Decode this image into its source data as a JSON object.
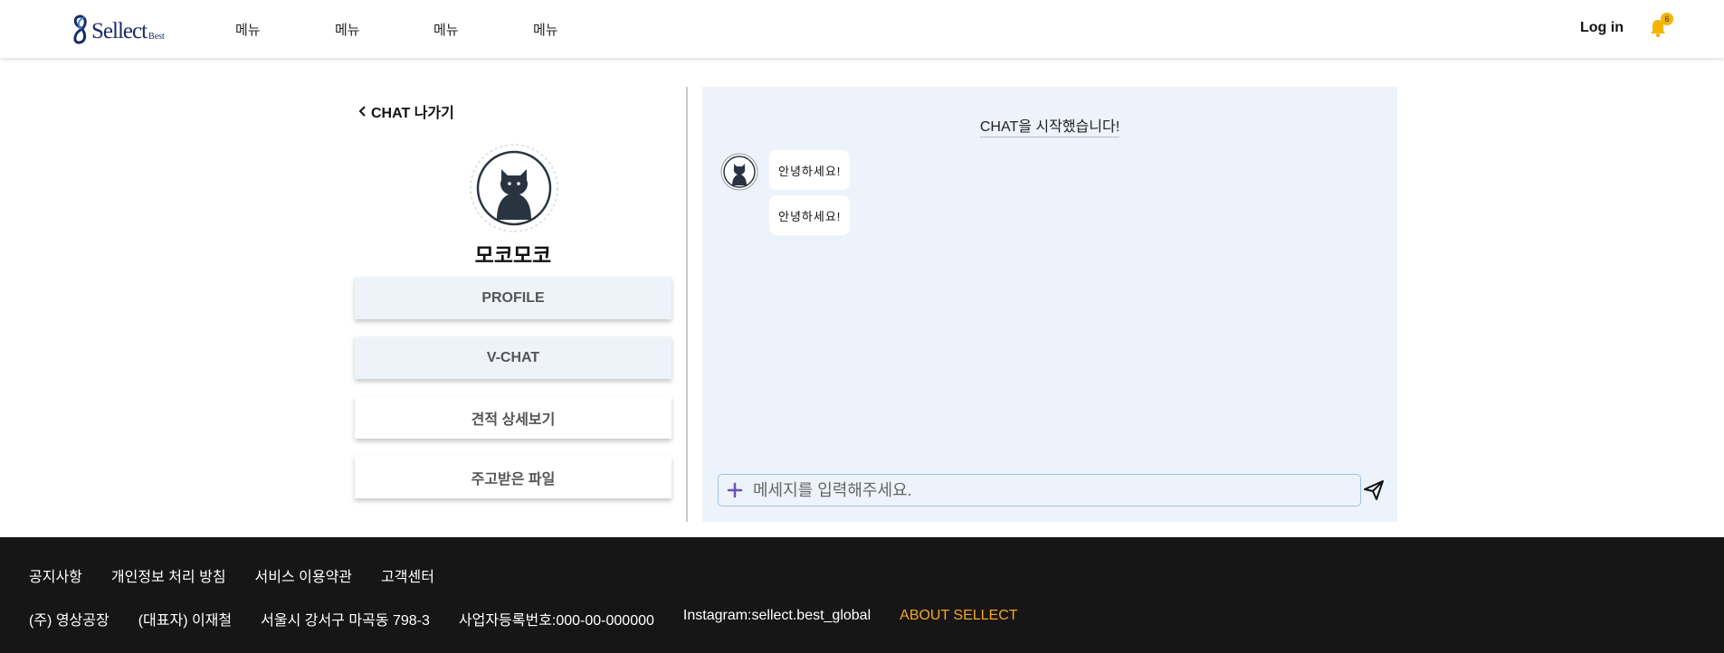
{
  "header": {
    "logo": {
      "text": "Sellect",
      "sub": "Best"
    },
    "nav": [
      "메뉴",
      "메뉴",
      "메뉴",
      "메뉴"
    ],
    "login_label": "Log in",
    "notification_count": "6"
  },
  "sidebar": {
    "back_label": "CHAT 나가기",
    "profile_name": "모코모코",
    "buttons": [
      "PROFILE",
      "V-CHAT",
      "견적 상세보기",
      "주고받은 파일"
    ]
  },
  "chat": {
    "start_notice": "CHAT을 시작했습니다!",
    "messages": [
      "안녕하세요!",
      "안녕하세요!"
    ],
    "input": {
      "placeholder": "메세지를 입력해주세요.",
      "value": ""
    }
  },
  "footer": {
    "links": [
      "공지사항",
      "개인정보 처리 방침",
      "서비스 이용약관",
      "고객센터"
    ],
    "info": [
      "(주) 영상공장",
      "(대표자) 이재철",
      "서울시 강서구 마곡동 798-3",
      "사업자등록번호:000-00-000000",
      "Instagram:sellect.best_global"
    ],
    "about_label": "ABOUT SELLECT"
  },
  "colors": {
    "accent": "#f5a623",
    "chat_bg": "#edf3fa",
    "footer_bg": "#161616",
    "brand": "#1a2a6c",
    "bell": "#f5b400"
  }
}
